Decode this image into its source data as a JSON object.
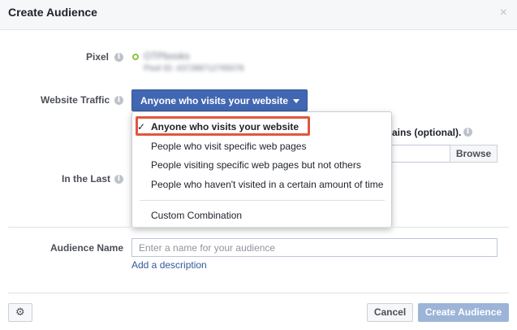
{
  "dialog": {
    "title": "Create Audience",
    "close_glyph": "×"
  },
  "form": {
    "pixel": {
      "label": "Pixel",
      "name": "OTPbooks",
      "id_text": "Pixel ID: 437288712765078",
      "status_color": "#8bc34a"
    },
    "website_traffic": {
      "label": "Website Traffic",
      "selected": "Anyone who visits your website",
      "options": [
        "Anyone who visits your website",
        "People who visit specific web pages",
        "People visiting specific web pages but not others",
        "People who haven't visited in a certain amount of time",
        "Custom Combination"
      ],
      "selected_check": "✓"
    },
    "partial_text": "ains (optional).",
    "browse_label": "Browse",
    "in_the_last_label": "In the Last",
    "audience_name": {
      "label": "Audience Name",
      "placeholder": "Enter a name for your audience",
      "value": ""
    },
    "add_description": "Add a description"
  },
  "footer": {
    "settings_icon": "gear-icon",
    "cancel_label": "Cancel",
    "create_label": "Create Audience"
  },
  "colors": {
    "primary_button": "#4267b2",
    "disabled_button": "#9cb4d8",
    "highlight_box": "#e0573e",
    "link": "#365899"
  }
}
